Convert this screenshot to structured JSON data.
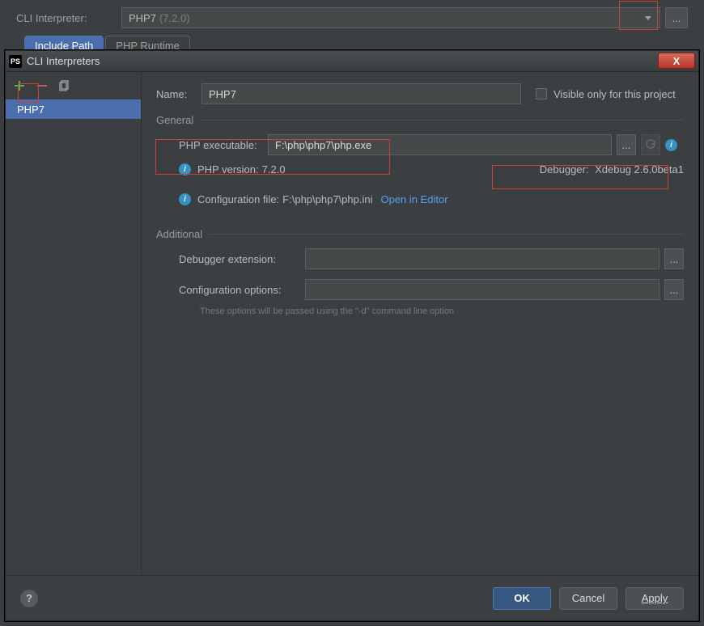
{
  "top": {
    "label": "CLI Interpreter:",
    "value": "PHP7",
    "version": "(7.2.0)"
  },
  "tabs": {
    "include_path": "Include Path",
    "php_runtime": "PHP Runtime"
  },
  "dialog": {
    "title": "CLI Interpreters",
    "ps_icon_text": "PS",
    "close_glyph": "X"
  },
  "sidebar": {
    "items": [
      "PHP7"
    ]
  },
  "form": {
    "name_label": "Name:",
    "name_value": "PHP7",
    "visible_only_label": "Visible only for this project"
  },
  "general": {
    "header": "General",
    "exe_label": "PHP executable:",
    "exe_value": "F:\\php\\php7\\php.exe",
    "version_label": "PHP version:",
    "version_value": "7.2.0",
    "debugger_label": "Debugger:",
    "debugger_value": "Xdebug 2.6.0beta1",
    "config_label": "Configuration file:",
    "config_value": "F:\\php\\php7\\php.ini",
    "open_editor": "Open in Editor"
  },
  "additional": {
    "header": "Additional",
    "dbg_ext_label": "Debugger extension:",
    "dbg_ext_value": "",
    "cfg_opts_label": "Configuration options:",
    "cfg_opts_value": "",
    "hint": "These options will be passed using the \"-d\" command line option"
  },
  "footer": {
    "help_glyph": "?",
    "ok": "OK",
    "cancel": "Cancel",
    "apply": "Apply"
  },
  "icons": {
    "ellipsis": "...",
    "info": "i"
  }
}
